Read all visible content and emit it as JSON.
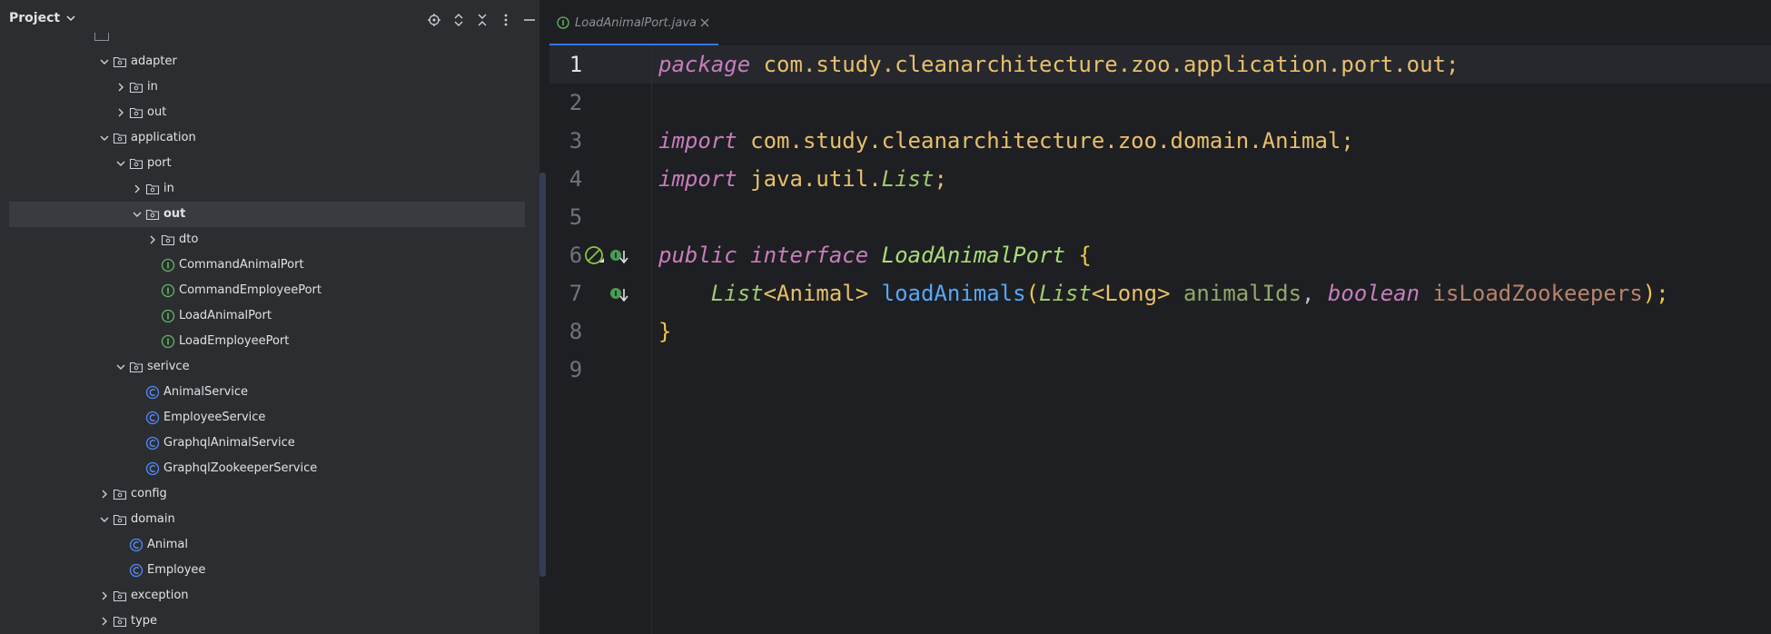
{
  "project_panel": {
    "title": "Project",
    "tools": [
      "locate-icon",
      "expand-all-icon",
      "collapse-all-icon",
      "options-icon",
      "hide-icon"
    ],
    "tree": [
      {
        "label": "adapter",
        "kind": "folder",
        "expanded": true
      },
      {
        "label": "in",
        "kind": "folder",
        "expanded": false
      },
      {
        "label": "out",
        "kind": "folder",
        "expanded": false
      },
      {
        "label": "application",
        "kind": "folder",
        "expanded": true
      },
      {
        "label": "port",
        "kind": "folder",
        "expanded": true
      },
      {
        "label": "in",
        "kind": "folder",
        "expanded": false
      },
      {
        "label": "out",
        "kind": "folder",
        "expanded": true,
        "selected": true
      },
      {
        "label": "dto",
        "kind": "folder",
        "expanded": false
      },
      {
        "label": "CommandAnimalPort",
        "kind": "interface"
      },
      {
        "label": "CommandEmployeePort",
        "kind": "interface"
      },
      {
        "label": "LoadAnimalPort",
        "kind": "interface"
      },
      {
        "label": "LoadEmployeePort",
        "kind": "interface"
      },
      {
        "label": "serivce",
        "kind": "folder",
        "expanded": true
      },
      {
        "label": "AnimalService",
        "kind": "class"
      },
      {
        "label": "EmployeeService",
        "kind": "class"
      },
      {
        "label": "GraphqlAnimalService",
        "kind": "class"
      },
      {
        "label": "GraphqlZookeeperService",
        "kind": "class"
      },
      {
        "label": "config",
        "kind": "folder",
        "expanded": false
      },
      {
        "label": "domain",
        "kind": "folder",
        "expanded": true
      },
      {
        "label": "Animal",
        "kind": "class"
      },
      {
        "label": "Employee",
        "kind": "class"
      },
      {
        "label": "exception",
        "kind": "folder",
        "expanded": false
      },
      {
        "label": "type",
        "kind": "folder",
        "expanded": false
      }
    ]
  },
  "editor": {
    "tab": {
      "label": "LoadAnimalPort.java",
      "icon": "interface-icon"
    },
    "line_numbers": [
      "1",
      "2",
      "3",
      "4",
      "5",
      "6",
      "7",
      "8",
      "9"
    ],
    "code": {
      "l1": {
        "kw": "package",
        "rest": " com.study.cleanarchitecture.zoo.application.port.out;"
      },
      "l3": {
        "kw": "import",
        "rest": " com.study.cleanarchitecture.zoo.domain.Animal;"
      },
      "l4": {
        "kw": "import",
        "pkg": " java.util.",
        "type": "List",
        "end": ";"
      },
      "l6": {
        "kw1": "public",
        "kw2": " interface",
        "name": " LoadAnimalPort",
        "brace": " {"
      },
      "l7": {
        "indent": "    ",
        "t1": "List",
        "g1": "<Animal>",
        "method": " loadAnimals",
        "open": "(",
        "t2": "List",
        "g2": "<Long>",
        "p1": " animalIds",
        "comma": ",",
        "kw": " boolean",
        "p2": " isLoadZookeepers",
        "close": ");"
      },
      "l8": {
        "brace": "}"
      }
    }
  }
}
